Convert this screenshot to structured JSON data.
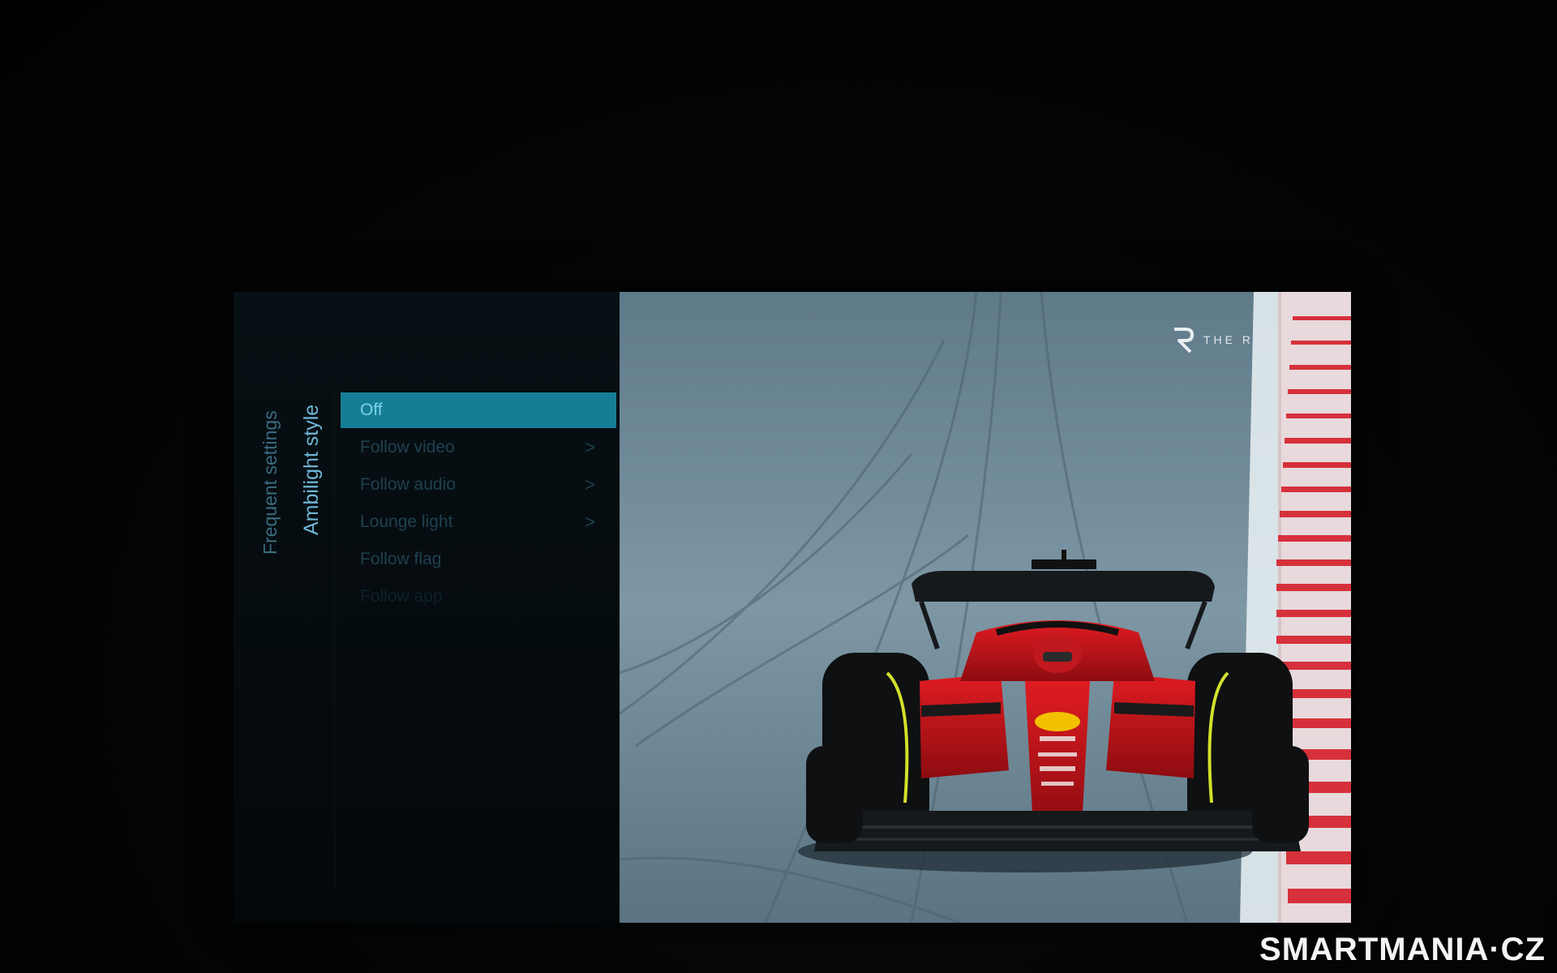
{
  "menu": {
    "breadcrumb_parent": "Frequent settings",
    "breadcrumb_current": "Ambilight style",
    "options": [
      {
        "label": "Off",
        "selected": true,
        "has_submenu": false
      },
      {
        "label": "Follow video",
        "selected": false,
        "has_submenu": true
      },
      {
        "label": "Follow audio",
        "selected": false,
        "has_submenu": true
      },
      {
        "label": "Lounge light",
        "selected": false,
        "has_submenu": true
      },
      {
        "label": "Follow flag",
        "selected": false,
        "has_submenu": false
      },
      {
        "label": "Follow app",
        "selected": false,
        "has_submenu": false,
        "disabled": true
      }
    ],
    "chevron_glyph": ">"
  },
  "video": {
    "channel_logo_text": "THE R",
    "channel_logo_icon": "r-logo-icon"
  },
  "watermark": "SMARTMANIA·CZ",
  "colors": {
    "accent": "#157e96",
    "selected_text": "#7fd1e6",
    "breadcrumb_current": "#6fb6d6",
    "breadcrumb_parent": "#3a6c7f",
    "car_red": "#c8151c"
  }
}
